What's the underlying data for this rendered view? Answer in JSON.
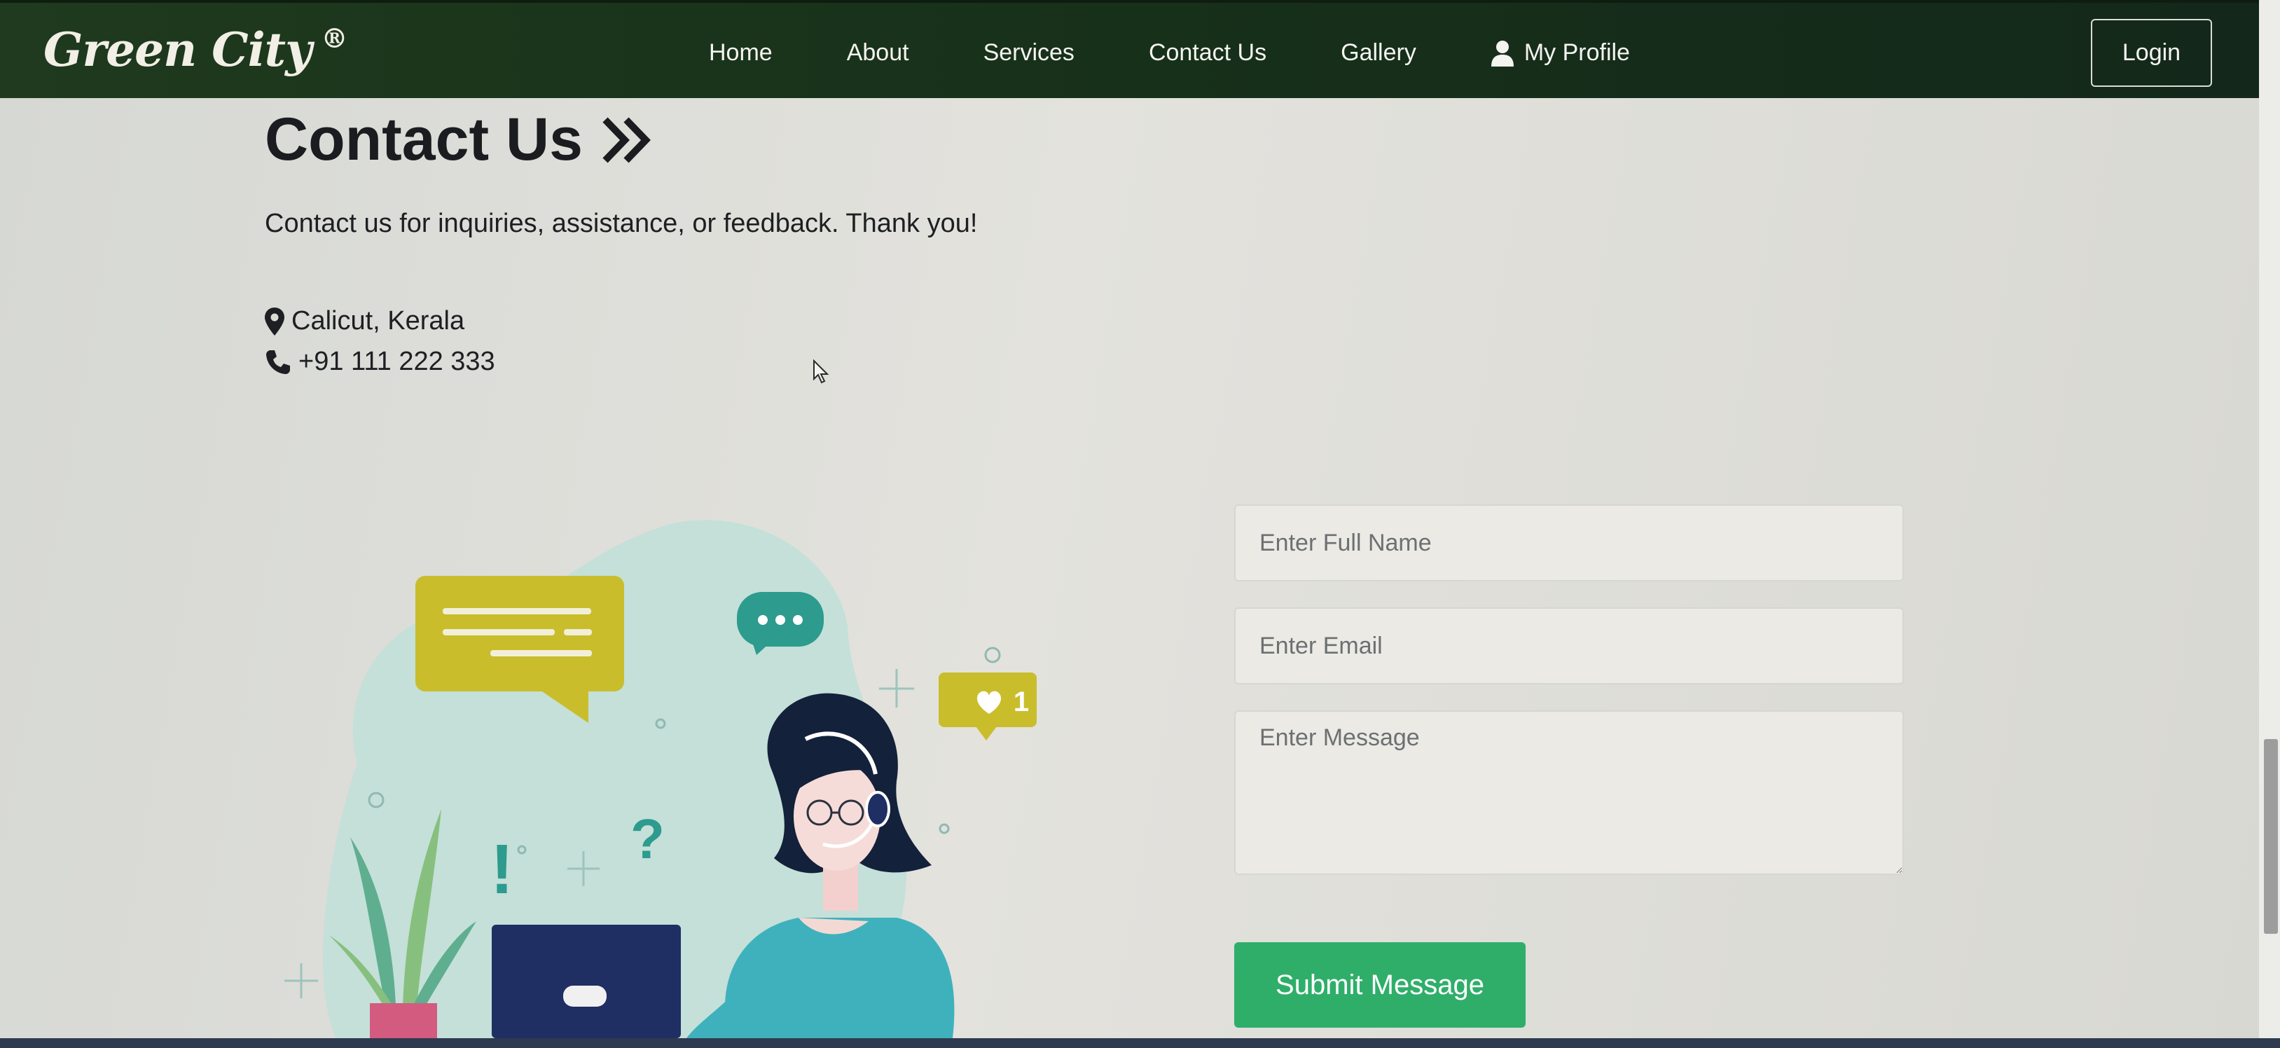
{
  "nav": {
    "brand": "Green City",
    "brand_mark": "®",
    "links": [
      "Home",
      "About",
      "Services",
      "Contact Us",
      "Gallery"
    ],
    "profile_label": "My Profile",
    "login_label": "Login"
  },
  "contact": {
    "title": "Contact Us",
    "intro": "Contact us for inquiries, assistance, or feedback. Thank you!",
    "location": "Calicut, Kerala",
    "phone": "+91 111 222 333"
  },
  "form": {
    "name_placeholder": "Enter Full Name",
    "email_placeholder": "Enter Email",
    "message_placeholder": "Enter Message",
    "submit_label": "Submit Message"
  },
  "illustration": {
    "like_count": "1"
  },
  "icons": [
    "user-icon",
    "chevrons-right-icon",
    "map-pin-icon",
    "phone-icon",
    "mouse-cursor-icon"
  ],
  "colors": {
    "navbar": "#1a331c",
    "submit": "#2fae6a",
    "accent_yellow": "#c9bd2c",
    "accent_teal": "#2d9b8d"
  }
}
